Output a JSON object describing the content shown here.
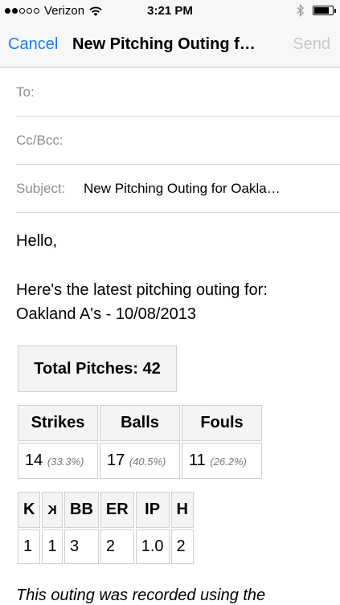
{
  "status_bar": {
    "carrier": "Verizon",
    "time": "3:21 PM",
    "signal_filled": 2,
    "signal_total": 5,
    "battery_level": 0.8
  },
  "nav": {
    "cancel_label": "Cancel",
    "title": "New Pitching Outing f…",
    "send_label": "Send"
  },
  "fields": {
    "to_label": "To:",
    "ccbcc_label": "Cc/Bcc:",
    "subject_label": "Subject:",
    "subject_value": "New Pitching Outing for Oakla…"
  },
  "body": {
    "greeting": "Hello,",
    "intro_line1": "Here's the latest pitching outing for:",
    "intro_line2": "Oakland A's - 10/08/2013",
    "total_pitches": "Total Pitches: 42",
    "split_headers": [
      "Strikes",
      "Balls",
      "Fouls"
    ],
    "split_values": [
      {
        "count": "14",
        "pct": "(33.3%)"
      },
      {
        "count": "17",
        "pct": "(40.5%)"
      },
      {
        "count": "11",
        "pct": "(26.2%)"
      }
    ],
    "line_headers": [
      "K",
      "K",
      "BB",
      "ER",
      "IP",
      "H"
    ],
    "line_values": [
      "1",
      "1",
      "3",
      "2",
      "1.0",
      "2"
    ],
    "footer": "This outing was recorded using the"
  },
  "colors": {
    "accent": "#1a7cf5",
    "disabled": "#c7c7cc",
    "label_gray": "#8e8e93"
  }
}
